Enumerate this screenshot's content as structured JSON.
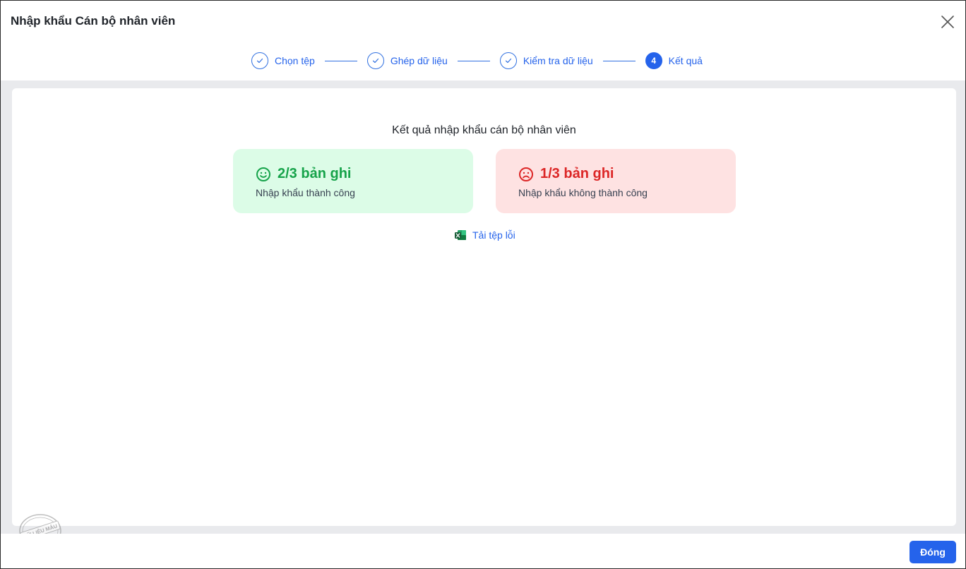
{
  "dialog": {
    "title": "Nhập khẩu Cán bộ nhân viên",
    "close_icon": "close-icon"
  },
  "stepper": {
    "steps": [
      {
        "label": "Chọn tệp",
        "state": "done"
      },
      {
        "label": "Ghép dữ liệu",
        "state": "done"
      },
      {
        "label": "Kiểm tra dữ liệu",
        "state": "done"
      },
      {
        "label": "Kết quả",
        "state": "active",
        "number": "4"
      }
    ]
  },
  "result": {
    "title": "Kết quả nhập khẩu cán bộ nhân viên",
    "success": {
      "value": "2/3 bản ghi",
      "label": "Nhập khẩu thành công",
      "icon": "smile-icon",
      "color": "#16a34a"
    },
    "fail": {
      "value": "1/3 bản ghi",
      "label": "Nhập khẩu không thành công",
      "icon": "frown-icon",
      "color": "#dc2626"
    },
    "download": {
      "label": "Tải tệp lỗi",
      "icon": "excel-icon"
    }
  },
  "watermark": {
    "text": "DỮ LIỆU MẪU"
  },
  "footer": {
    "close_label": "Đóng"
  },
  "colors": {
    "accent": "#2563eb",
    "background": "#e9eaed"
  }
}
